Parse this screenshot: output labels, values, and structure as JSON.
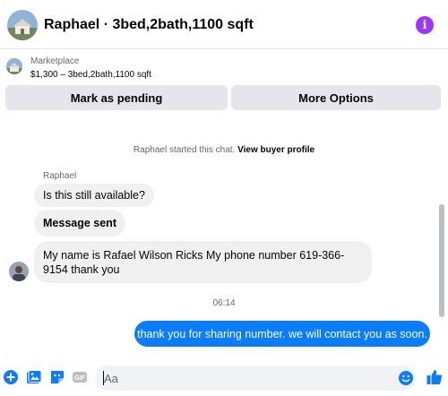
{
  "header": {
    "title": "Raphael · 3bed,2bath,1100 sqft",
    "info_icon": "info-icon",
    "accent": "#a033ff"
  },
  "listing": {
    "label": "Marketplace",
    "summary": "$1,300 – 3bed,2bath,1100 sqft"
  },
  "actions": {
    "pending_label": "Mark as pending",
    "more_label": "More Options"
  },
  "chat": {
    "system_note": "Raphael started this chat.",
    "system_link": "View buyer profile",
    "sender_name": "Raphael",
    "incoming": [
      "Is this still available?",
      "Message sent",
      "My name is Rafael Wilson Ricks My phone number 619-366-9154 thank you"
    ],
    "timestamp": "06:14",
    "outgoing": [
      "thank you for sharing number. we will contact you as soon."
    ]
  },
  "composer": {
    "placeholder": "Aa",
    "value": "",
    "icons": [
      "plus-icon",
      "photo-icon",
      "sticker-icon",
      "gif-icon",
      "emoji-icon",
      "thumbs-up-icon"
    ]
  },
  "colors": {
    "brand_blue": "#0a7cff",
    "incoming_bubble": "#f0f0f0",
    "button_gray": "#e4e6eb"
  }
}
